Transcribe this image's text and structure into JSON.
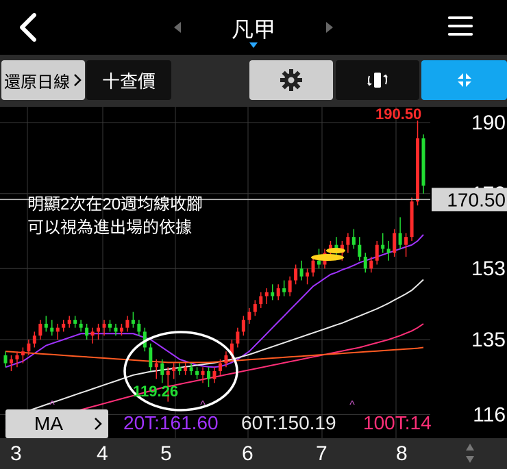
{
  "header": {
    "title": "凡甲"
  },
  "toolbar": {
    "restore_label": "還原日線",
    "price_label": "十查價"
  },
  "annotation": {
    "line1": "明顯2次在20週均線收腳",
    "line2": "可以視為進出場的依據"
  },
  "low_label": "119.26",
  "high_label": "190.50",
  "ma_button": {
    "label": "MA"
  },
  "ma_legend": {
    "ma20": "20T:161.60",
    "ma60": "60T:150.19",
    "ma100": "100T:14"
  },
  "colors": {
    "up": "#ff2b2b",
    "down": "#22dd33",
    "ma20": "#a033ff",
    "ma60": "#e8e8e8",
    "ma100": "#ff2f78",
    "ma_long": "#ff5a22",
    "accent": "#13a6f0"
  },
  "chart_data": {
    "type": "candlestick",
    "y_ticks": [
      "190",
      "172",
      "153",
      "135",
      "116"
    ],
    "x_ticks": [
      "3",
      "4",
      "5",
      "6",
      "7",
      "8"
    ],
    "current_price": "170.50",
    "ylim": [
      110,
      194
    ],
    "candles": [
      [
        131,
        132,
        128,
        129
      ],
      [
        129,
        131,
        127,
        130
      ],
      [
        130,
        132,
        128,
        131
      ],
      [
        131,
        133,
        129,
        132
      ],
      [
        132,
        135,
        131,
        134
      ],
      [
        134,
        137,
        133,
        136
      ],
      [
        136,
        140,
        135,
        139
      ],
      [
        139,
        141,
        137,
        138
      ],
      [
        138,
        140,
        136,
        137
      ],
      [
        137,
        139,
        135,
        138
      ],
      [
        138,
        140,
        137,
        139
      ],
      [
        139,
        141,
        138,
        140
      ],
      [
        140,
        141,
        138,
        139
      ],
      [
        139,
        140,
        137,
        138
      ],
      [
        138,
        139,
        135,
        136
      ],
      [
        136,
        138,
        134,
        137
      ],
      [
        137,
        139,
        135,
        138
      ],
      [
        138,
        140,
        136,
        139
      ],
      [
        139,
        140,
        137,
        138
      ],
      [
        138,
        139,
        136,
        137
      ],
      [
        137,
        139,
        136,
        138
      ],
      [
        138,
        141,
        137,
        140
      ],
      [
        140,
        142,
        138,
        139
      ],
      [
        139,
        140,
        136,
        137
      ],
      [
        137,
        138,
        132,
        133
      ],
      [
        133,
        134,
        127,
        128
      ],
      [
        128,
        130,
        125,
        129
      ],
      [
        129,
        130,
        124,
        126
      ],
      [
        126,
        128,
        119.26,
        127
      ],
      [
        127,
        129,
        125,
        128
      ],
      [
        128,
        129,
        126,
        127
      ],
      [
        127,
        129,
        126,
        128
      ],
      [
        128,
        129,
        126,
        127
      ],
      [
        127,
        128,
        125,
        126
      ],
      [
        126,
        128,
        124,
        127
      ],
      [
        127,
        128,
        123,
        125
      ],
      [
        125,
        128,
        124,
        127
      ],
      [
        127,
        130,
        126,
        129
      ],
      [
        129,
        132,
        128,
        131
      ],
      [
        131,
        135,
        130,
        134
      ],
      [
        134,
        138,
        133,
        137
      ],
      [
        137,
        141,
        136,
        140
      ],
      [
        140,
        143,
        139,
        142
      ],
      [
        142,
        145,
        141,
        144
      ],
      [
        144,
        147,
        143,
        146
      ],
      [
        146,
        148,
        144,
        147
      ],
      [
        147,
        149,
        145,
        146
      ],
      [
        146,
        149,
        145,
        148
      ],
      [
        148,
        150,
        146,
        147
      ],
      [
        147,
        151,
        146,
        150
      ],
      [
        150,
        154,
        149,
        153
      ],
      [
        153,
        155,
        150,
        151
      ],
      [
        151,
        153,
        149,
        152
      ],
      [
        152,
        156,
        151,
        155
      ],
      [
        155,
        158,
        153,
        154
      ],
      [
        154,
        158,
        153,
        157
      ],
      [
        157,
        160,
        155,
        159
      ],
      [
        159,
        161,
        156,
        157
      ],
      [
        157,
        160,
        155,
        159
      ],
      [
        159,
        162,
        157,
        161
      ],
      [
        161,
        163,
        158,
        159
      ],
      [
        159,
        161,
        155,
        156
      ],
      [
        156,
        157,
        152,
        153
      ],
      [
        153,
        156,
        152,
        155
      ],
      [
        155,
        160,
        154,
        159
      ],
      [
        159,
        162,
        157,
        158
      ],
      [
        158,
        160,
        155,
        157
      ],
      [
        157,
        163,
        156,
        162
      ],
      [
        162,
        166,
        158,
        159
      ],
      [
        159,
        162,
        156,
        161
      ],
      [
        161,
        171,
        160,
        170
      ],
      [
        170,
        190.5,
        169,
        186
      ],
      [
        186,
        187,
        172,
        174
      ]
    ],
    "series": [
      {
        "name": "20T",
        "values": [
          128,
          128.5,
          129,
          129.5,
          130.5,
          131.5,
          132.5,
          133.5,
          134,
          134.5,
          135,
          135.5,
          136,
          136.5,
          136.5,
          136.5,
          136.5,
          136.5,
          136.5,
          136.5,
          136.5,
          136.5,
          136.5,
          136,
          135.5,
          135,
          134,
          133,
          132,
          131,
          130,
          129.5,
          129,
          128.5,
          128.3,
          128.1,
          128,
          128.2,
          128.6,
          129.2,
          130,
          131,
          132,
          133.5,
          135,
          136.5,
          138,
          139.5,
          141,
          142.5,
          144,
          145.5,
          147,
          148.5,
          149.5,
          150.5,
          151.5,
          152,
          152.7,
          153.2,
          153.8,
          154.5,
          155,
          155.5,
          156,
          156.5,
          157,
          157.5,
          158,
          158.5,
          159,
          160,
          161.6
        ]
      },
      {
        "name": "60T",
        "values": [
          115,
          115.5,
          116,
          116.5,
          117,
          117.5,
          118,
          118.5,
          119,
          119.5,
          120,
          120.5,
          121,
          121.5,
          122,
          122.5,
          123,
          123.5,
          124,
          124.5,
          125,
          125.5,
          126,
          126.3,
          126.6,
          126.9,
          127.1,
          127.3,
          127.5,
          127.7,
          127.9,
          128.1,
          128.3,
          128.5,
          128.7,
          128.9,
          129.1,
          129.4,
          129.7,
          130,
          130.4,
          130.8,
          131.2,
          131.7,
          132.2,
          132.7,
          133.2,
          133.7,
          134.2,
          134.7,
          135.2,
          135.7,
          136.2,
          136.7,
          137.2,
          137.7,
          138.2,
          138.7,
          139.2,
          139.8,
          140.4,
          141,
          141.6,
          142.2,
          142.8,
          143.5,
          144.2,
          145,
          145.8,
          146.6,
          147.5,
          148.8,
          150.19
        ]
      },
      {
        "name": "100T",
        "values": [
          112,
          112.4,
          112.8,
          113.2,
          113.6,
          114,
          114.4,
          114.8,
          115.2,
          115.6,
          116,
          116.4,
          116.8,
          117.2,
          117.6,
          118,
          118.4,
          118.8,
          119.2,
          119.6,
          120,
          120.4,
          120.8,
          121.2,
          121.6,
          122,
          122.4,
          122.8,
          123.1,
          123.4,
          123.7,
          124,
          124.3,
          124.6,
          124.9,
          125.2,
          125.5,
          125.8,
          126.1,
          126.4,
          126.7,
          127,
          127.3,
          127.6,
          127.9,
          128.2,
          128.5,
          128.8,
          129.1,
          129.4,
          129.7,
          130,
          130.3,
          130.6,
          130.9,
          131.2,
          131.5,
          131.8,
          132.1,
          132.4,
          132.7,
          133,
          133.4,
          133.8,
          134.2,
          134.6,
          135,
          135.5,
          136,
          136.6,
          137.2,
          138,
          139
        ]
      },
      {
        "name": "long",
        "values": [
          132,
          131.9,
          131.8,
          131.7,
          131.6,
          131.5,
          131.4,
          131.3,
          131.2,
          131.1,
          131,
          130.9,
          130.8,
          130.7,
          130.6,
          130.5,
          130.4,
          130.3,
          130.2,
          130.1,
          130,
          129.9,
          129.8,
          129.7,
          129.6,
          129.5,
          129.4,
          129.3,
          129.2,
          129.2,
          129.2,
          129.2,
          129.2,
          129.2,
          129.2,
          129.2,
          129.3,
          129.4,
          129.5,
          129.6,
          129.7,
          129.8,
          129.9,
          130,
          130.1,
          130.2,
          130.3,
          130.4,
          130.5,
          130.6,
          130.7,
          130.8,
          130.9,
          131,
          131.1,
          131.2,
          131.3,
          131.4,
          131.5,
          131.6,
          131.7,
          131.8,
          131.9,
          132,
          132.1,
          132.2,
          132.3,
          132.4,
          132.5,
          132.6,
          132.7,
          132.8,
          133
        ]
      }
    ]
  }
}
